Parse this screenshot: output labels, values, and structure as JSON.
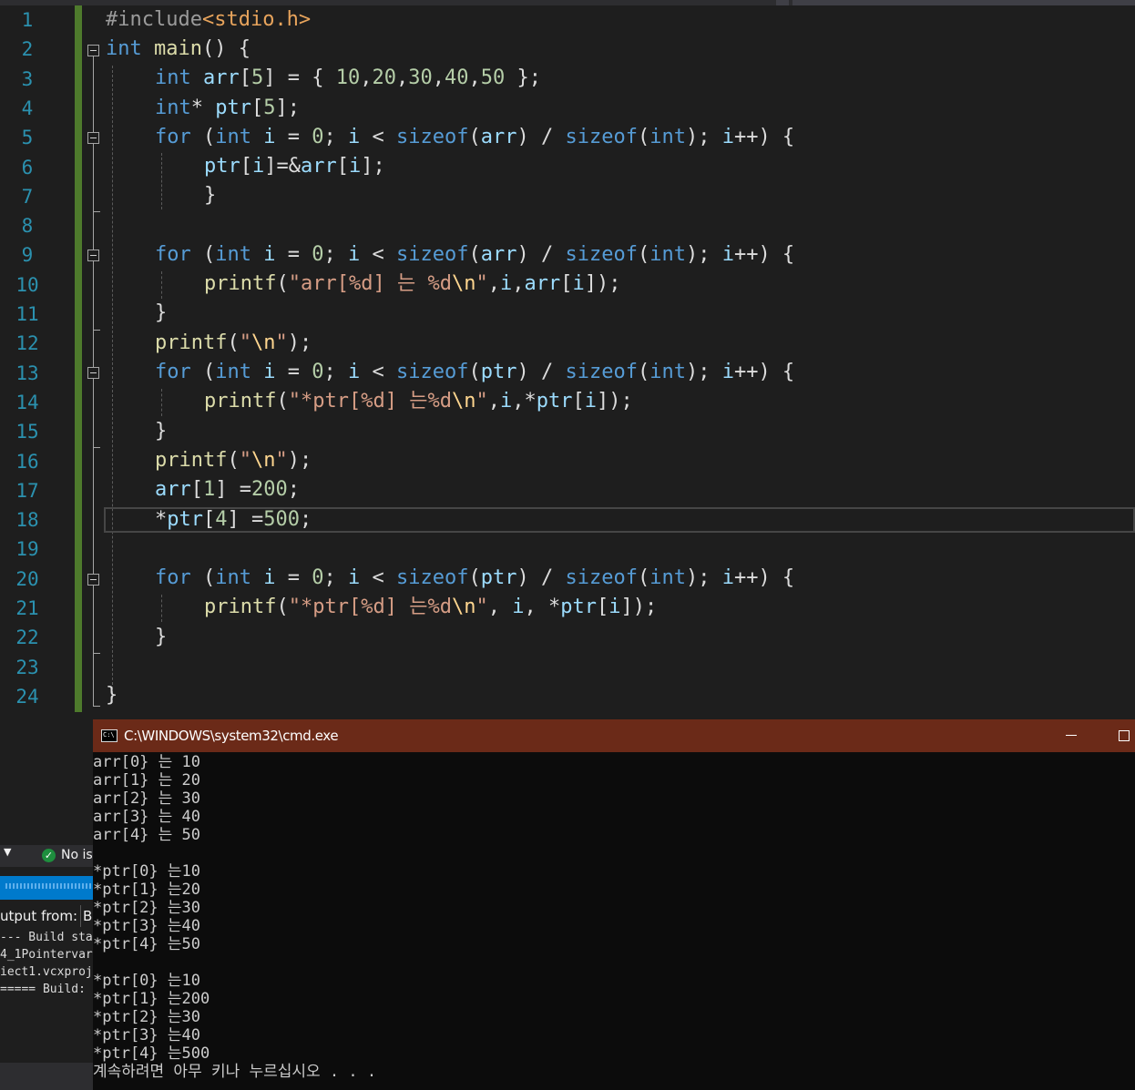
{
  "editor": {
    "line_numbers": [
      "1",
      "2",
      "3",
      "4",
      "5",
      "6",
      "7",
      "8",
      "9",
      "10",
      "11",
      "12",
      "13",
      "14",
      "15",
      "16",
      "17",
      "18",
      "19",
      "20",
      "21",
      "22",
      "23",
      "24"
    ],
    "code": {
      "l1_pp": "#include",
      "l1_inc": "<stdio.h>",
      "l2_kw": "int",
      "l2_fn": " main",
      "l2_rest": "() {",
      "l3": [
        "int",
        " arr",
        "[",
        "5",
        "] = { ",
        "10",
        ",",
        "20",
        ",",
        "30",
        ",",
        "40",
        ",",
        "50",
        " };"
      ],
      "l4": [
        "int",
        "* ",
        "ptr",
        "[",
        "5",
        "];"
      ],
      "for_kw": "for",
      "int_kw": "int",
      "var_i": "i",
      "zero": "0",
      "sizeof_kw": "sizeof",
      "arr_var": "arr",
      "ptr_var": "ptr",
      "l6": [
        "ptr",
        "[",
        "i",
        "]=&",
        "arr",
        "[",
        "i",
        "];"
      ],
      "close_brace": "}",
      "printf_fn": "printf",
      "l10_str_a": "\"arr[",
      "l10_pct1": "%d",
      "l10_str_b": "] 는 ",
      "l10_pct2": "%d",
      "esc_n": "\\n",
      "quote": "\"",
      "l10_args": [
        ",",
        "i",
        ",",
        "arr",
        "[",
        "i",
        "]);"
      ],
      "l12_args": ");",
      "l14_str_a": "\"*ptr[",
      "l14_str_b": "] 는",
      "l14_args": [
        ",",
        "i",
        ",*",
        "ptr",
        "[",
        "i",
        "]);"
      ],
      "l17": [
        "arr",
        "[",
        "1",
        "] =",
        "200",
        ";"
      ],
      "l18": [
        "*",
        "ptr",
        "[",
        "4",
        "] =",
        "500",
        ";"
      ],
      "l21_args": [
        ", ",
        "i",
        ", *",
        "ptr",
        "[",
        "i",
        "]);"
      ]
    }
  },
  "left_panel": {
    "status_text": "No is",
    "output_label": "utput from:",
    "output_value": "B",
    "lines": [
      "--- Build sta",
      "4_1Pointervar",
      "iect1.vcxproj",
      "===== Build:"
    ]
  },
  "console": {
    "title": "C:\\WINDOWS\\system32\\cmd.exe",
    "icon_text": "C:\\",
    "lines": [
      "arr[0} 는 10",
      "arr[1} 는 20",
      "arr[2} 는 30",
      "arr[3} 는 40",
      "arr[4} 는 50",
      "",
      "*ptr[0} 는10",
      "*ptr[1} 는20",
      "*ptr[2} 는30",
      "*ptr[3} 는40",
      "*ptr[4} 는50",
      "",
      "*ptr[0} 는10",
      "*ptr[1} 는200",
      "*ptr[2} 는30",
      "*ptr[3} 는40",
      "*ptr[4} 는500",
      "계속하려면 아무 키나 누르십시오 . . ."
    ]
  }
}
